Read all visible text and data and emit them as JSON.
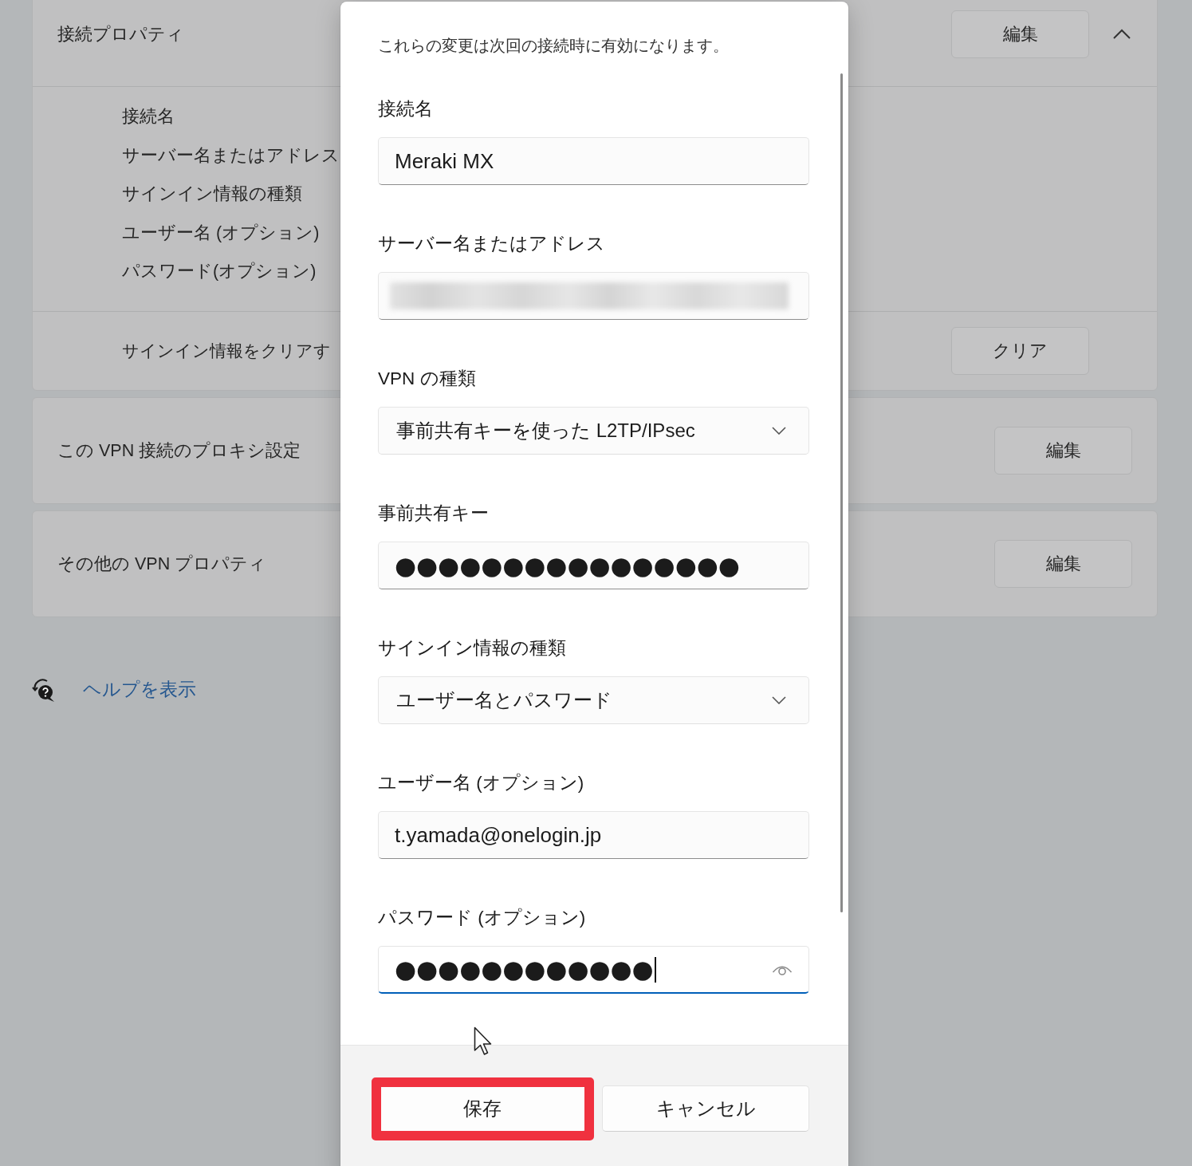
{
  "background": {
    "connection_properties": {
      "title": "接続プロパティ",
      "button": "編集",
      "expanded": true,
      "details": [
        "接続名",
        "サーバー名またはアドレス",
        "サインイン情報の種類",
        "ユーザー名 (オプション)",
        "パスワード(オプション)"
      ],
      "action_label": "サインイン情報をクリアす",
      "action_button": "クリア"
    },
    "sections": [
      {
        "title": "この VPN 接続のプロキシ設定",
        "button": "編集"
      },
      {
        "title": "その他の VPN プロパティ",
        "button": "編集"
      }
    ],
    "help_link": "ヘルプを表示"
  },
  "dialog": {
    "notice": "これらの変更は次回の接続時に有効になります。",
    "fields": [
      {
        "kind": "text",
        "label": "接続名",
        "value": "Meraki MX",
        "focused": false
      },
      {
        "kind": "redacted",
        "label": "サーバー名またはアドレス"
      },
      {
        "kind": "dropdown",
        "label": "VPN の種類",
        "value": "事前共有キーを使った L2TP/IPsec"
      },
      {
        "kind": "password",
        "label": "事前共有キー",
        "value": "●●●●●●●●●●●●●●●●",
        "focused": false
      },
      {
        "kind": "dropdown",
        "label": "サインイン情報の種類",
        "value": "ユーザー名とパスワード"
      },
      {
        "kind": "text",
        "label": "ユーザー名 (オプション)",
        "value": "t.yamada@onelogin.jp",
        "focused": false
      },
      {
        "kind": "password",
        "label": "パスワード (オプション)",
        "value": "●●●●●●●●●●●●",
        "focused": true
      }
    ],
    "buttons": [
      {
        "label": "保存",
        "highlighted": true
      },
      {
        "label": "キャンセル",
        "highlighted": false
      }
    ]
  }
}
